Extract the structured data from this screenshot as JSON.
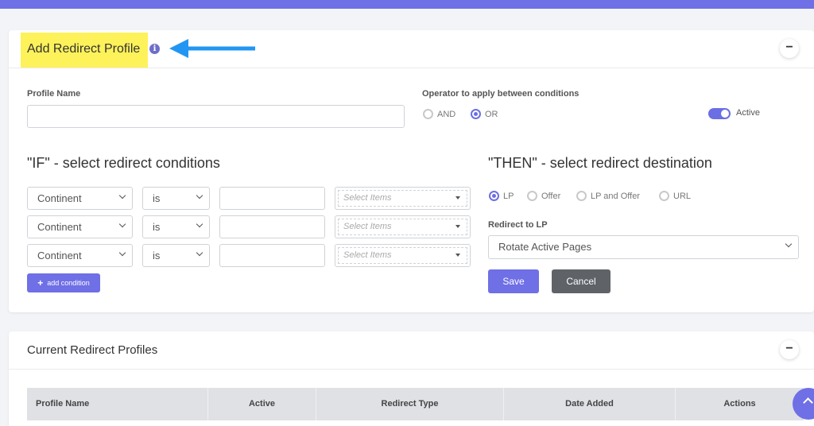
{
  "add_profile": {
    "title": "Add Redirect Profile",
    "info_icon": "info-icon",
    "collapse_label": "−",
    "profile_name_label": "Profile Name",
    "profile_name_value": "",
    "operator_label": "Operator to apply between conditions",
    "operator_options": [
      "AND",
      "OR"
    ],
    "operator_selected": "OR",
    "active_label": "Active",
    "active_on": true
  },
  "conditions": {
    "title": "\"IF\" - select redirect conditions",
    "rows": [
      {
        "field": "Continent",
        "operator": "is",
        "value": "",
        "items_placeholder": "Select Items"
      },
      {
        "field": "Continent",
        "operator": "is",
        "value": "",
        "items_placeholder": "Select Items"
      },
      {
        "field": "Continent",
        "operator": "is",
        "value": "",
        "items_placeholder": "Select Items"
      }
    ],
    "add_label": "add condition"
  },
  "destination": {
    "title": "\"THEN\" - select redirect destination",
    "types": [
      "LP",
      "Offer",
      "LP and Offer",
      "URL"
    ],
    "type_selected": "LP",
    "redirect_label": "Redirect to LP",
    "redirect_value": "Rotate Active Pages",
    "save_label": "Save",
    "cancel_label": "Cancel"
  },
  "current_profiles": {
    "title": "Current Redirect Profiles",
    "collapse_label": "−",
    "columns": [
      "Profile Name",
      "Active",
      "Redirect Type",
      "Date Added",
      "Actions"
    ]
  },
  "colors": {
    "accent": "#6f6fe6",
    "highlight": "#fdf25a",
    "arrow": "#2196f3",
    "secondary_button": "#5f6368"
  }
}
